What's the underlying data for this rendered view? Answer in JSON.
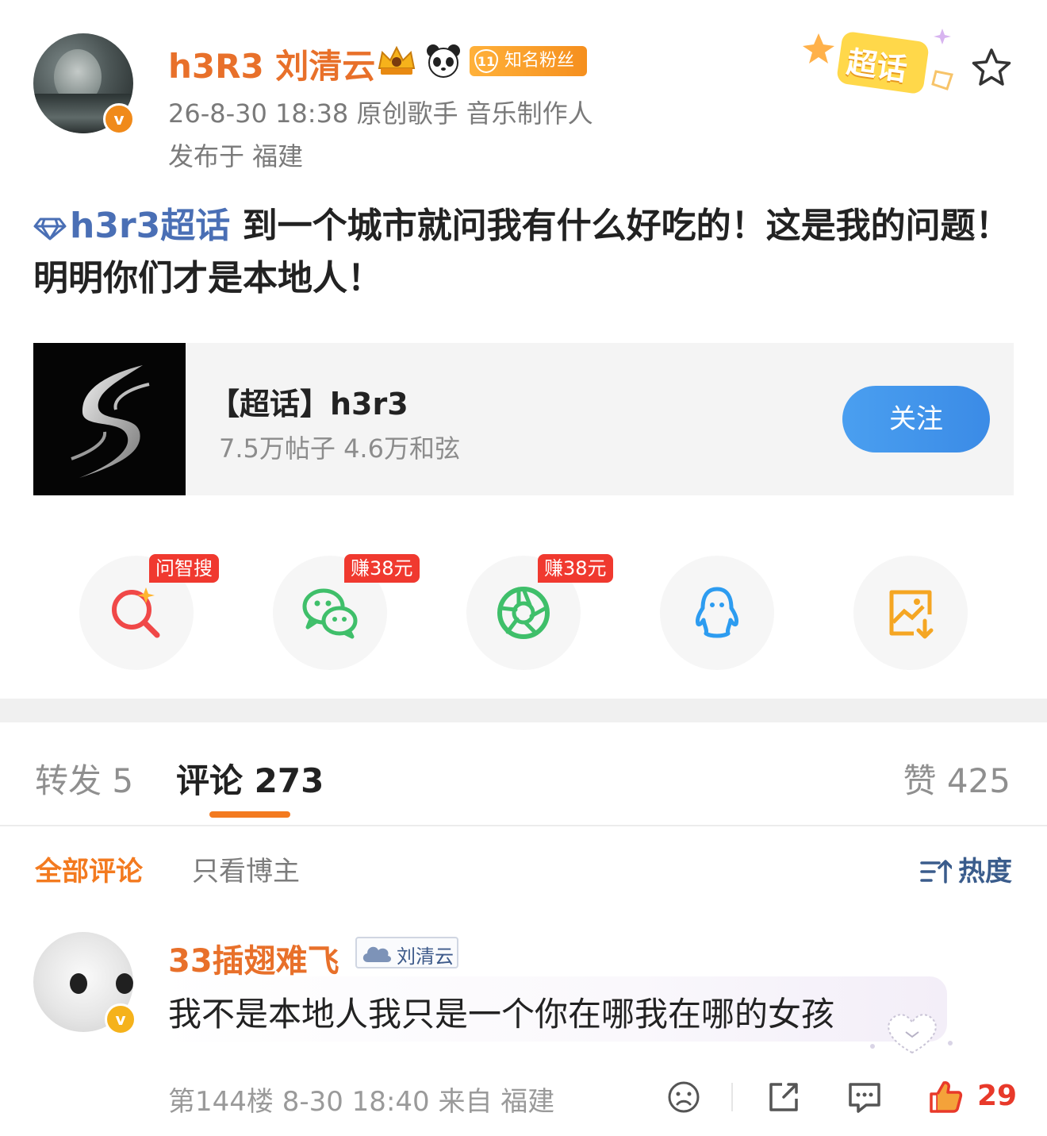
{
  "post": {
    "author": {
      "name": "h3R3 刘清云",
      "verified_icon": "v-badge-icon",
      "badges": [
        "crown-badge-icon",
        "panda-badge-icon"
      ],
      "fan_badge_level": "11",
      "fan_badge_text": "知名粉丝"
    },
    "meta_line": "26-8-30 18:38  原创歌手 音乐制作人",
    "location": "发布于 福建",
    "supertopic_sticker": "超话",
    "body_tag": "h3r3超话",
    "body_text": " 到一个城市就问我有什么好吃的！这是我的问题！明明你们才是本地人！"
  },
  "topic_card": {
    "title": "【超话】h3r3",
    "stats": "7.5万帖子 4.6万和弦",
    "follow_label": "关注"
  },
  "share_row": [
    {
      "icon": "ai-search-icon",
      "tag": "问智搜",
      "color": "#f04848"
    },
    {
      "icon": "wechat-icon",
      "tag": "赚38元",
      "color": "#3fbf6a"
    },
    {
      "icon": "moments-icon",
      "tag": "赚38元",
      "color": "#3fbf6a"
    },
    {
      "icon": "qq-icon",
      "tag": "",
      "color": "#2d9cf0"
    },
    {
      "icon": "save-image-icon",
      "tag": "",
      "color": "#f5a623"
    }
  ],
  "tabs": {
    "repost": "转发 5",
    "comments": "评论 273",
    "likes": "赞 425"
  },
  "filters": {
    "all": "全部评论",
    "author_only": "只看博主",
    "sort": "热度"
  },
  "comment": {
    "author": "33插翅难飞",
    "badge": "刘清云",
    "text": "我不是本地人我只是一个你在哪我在哪的女孩",
    "footer": "第144楼 8-30 18:40 来自 福建",
    "like_count": "29"
  },
  "colors": {
    "brand_orange": "#e8702a",
    "tag_blue": "#4a6fb5",
    "follow_blue": "#3b8be6",
    "like_red": "#e8392a"
  }
}
